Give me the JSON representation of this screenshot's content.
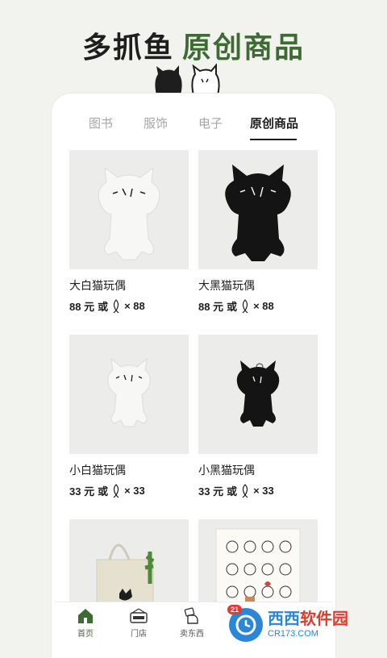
{
  "headline": {
    "part1": "多抓鱼",
    "part2": "原创商品"
  },
  "tabs": [
    {
      "label": "图书",
      "active": false
    },
    {
      "label": "服饰",
      "active": false
    },
    {
      "label": "电子",
      "active": false
    },
    {
      "label": "原创商品",
      "active": true
    }
  ],
  "products": [
    {
      "name": "大白猫玩偶",
      "price": "88 元",
      "or": "或",
      "times": "× 88",
      "color": "white"
    },
    {
      "name": "大黑猫玩偶",
      "price": "88 元",
      "or": "或",
      "times": "× 88",
      "color": "black"
    },
    {
      "name": "小白猫玩偶",
      "price": "33 元",
      "or": "或",
      "times": "× 33",
      "color": "white"
    },
    {
      "name": "小黑猫玩偶",
      "price": "33 元",
      "or": "或",
      "times": "× 33",
      "color": "black"
    }
  ],
  "nav": [
    {
      "label": "首页",
      "icon": "home-icon",
      "active": true
    },
    {
      "label": "门店",
      "icon": "store-open-icon",
      "active": false
    },
    {
      "label": "卖东西",
      "icon": "sell-hand-icon",
      "active": false
    }
  ],
  "watermark": {
    "badge": "21",
    "text1a": "西西",
    "text1b": "软件园",
    "text2": "CR173.COM"
  },
  "colors": {
    "accent": "#3e6b34",
    "text": "#1e1e1e",
    "tab_inactive": "#a6a6a6"
  }
}
